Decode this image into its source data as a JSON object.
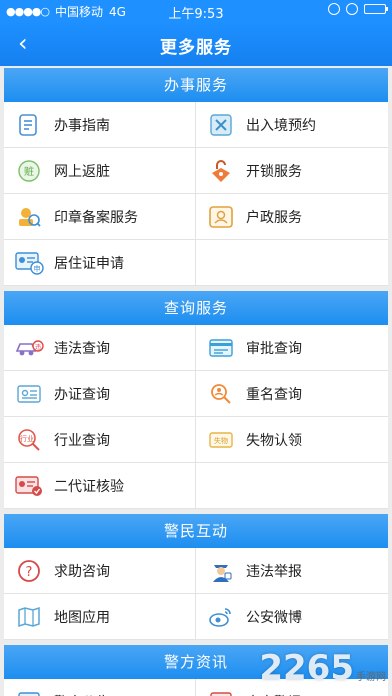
{
  "status_bar": {
    "carrier": "中国移动",
    "network": "4G",
    "time": "上午9:53"
  },
  "nav": {
    "back_icon": "‹",
    "title": "更多服务"
  },
  "sections": [
    {
      "title": "办事服务",
      "items": [
        {
          "label": "办事指南",
          "icon": "document-list-icon"
        },
        {
          "label": "出入境预约",
          "icon": "exit-entry-icon"
        },
        {
          "label": "网上返脏",
          "icon": "return-goods-icon"
        },
        {
          "label": "开锁服务",
          "icon": "unlock-icon"
        },
        {
          "label": "印章备案服务",
          "icon": "seal-icon"
        },
        {
          "label": "户政服务",
          "icon": "household-icon"
        },
        {
          "label": "居住证申请",
          "icon": "residence-permit-icon"
        },
        {
          "label": "",
          "icon": ""
        }
      ]
    },
    {
      "title": "查询服务",
      "items": [
        {
          "label": "违法查询",
          "icon": "traffic-violation-icon"
        },
        {
          "label": "审批查询",
          "icon": "approval-card-icon"
        },
        {
          "label": "办证查询",
          "icon": "certificate-icon"
        },
        {
          "label": "重名查询",
          "icon": "name-search-icon"
        },
        {
          "label": "行业查询",
          "icon": "industry-search-icon"
        },
        {
          "label": "失物认领",
          "icon": "lost-found-icon"
        },
        {
          "label": "二代证核验",
          "icon": "id-card-verify-icon"
        },
        {
          "label": "",
          "icon": ""
        }
      ]
    },
    {
      "title": "警民互动",
      "items": [
        {
          "label": "求助咨询",
          "icon": "help-icon"
        },
        {
          "label": "违法举报",
          "icon": "police-report-icon"
        },
        {
          "label": "地图应用",
          "icon": "map-icon"
        },
        {
          "label": "公安微博",
          "icon": "weibo-icon"
        }
      ]
    },
    {
      "title": "警方资讯",
      "items": [
        {
          "label": "警方公告",
          "icon": "announcement-icon"
        },
        {
          "label": "南宁警讯",
          "icon": "police-news-icon"
        }
      ]
    }
  ],
  "watermark": {
    "text": "2265",
    "sub": "手游网"
  },
  "colors": {
    "primary": "#1e90ff",
    "header": "#2d96f2",
    "divider": "#e3e3e3",
    "background": "#ececec"
  }
}
